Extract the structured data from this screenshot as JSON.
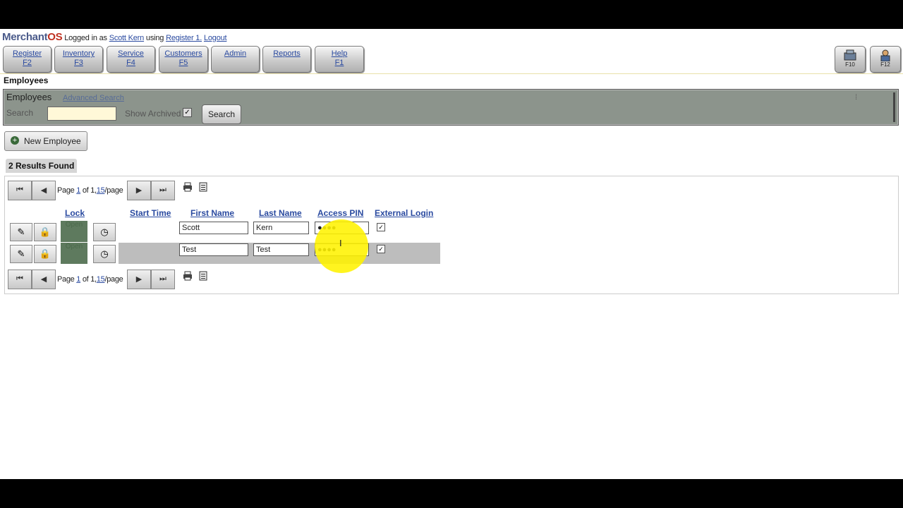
{
  "header": {
    "brand_main": "Merchant",
    "brand_os": "OS",
    "logged_in_as": "Logged in as",
    "user": "Scott Kern",
    "using": "using",
    "register": "Register 1.",
    "logout": "Logout"
  },
  "nav": [
    {
      "label": "Register",
      "key": "F2"
    },
    {
      "label": "Inventory",
      "key": "F3"
    },
    {
      "label": "Service",
      "key": "F4"
    },
    {
      "label": "Customers",
      "key": "F5"
    },
    {
      "label": "Admin",
      "key": ""
    },
    {
      "label": "Reports",
      "key": ""
    },
    {
      "label": "Help",
      "key": "F1"
    }
  ],
  "right_buttons": [
    {
      "label": "F10",
      "icon": "register-icon"
    },
    {
      "label": "F12",
      "icon": "user-icon"
    }
  ],
  "page_title": "Employees",
  "filter_panel": {
    "title": "Employees",
    "link": "Advanced Search",
    "search_label": "Search",
    "search_value": "",
    "archived_label": "Show Archived",
    "search_button": "Search"
  },
  "new_employee_button": "New Employee",
  "results_label": "2 Results Found",
  "pager": {
    "page_word": "Page",
    "page": "1",
    "of": "of",
    "total": "1",
    "per_page": "15",
    "per_page_suffix": "/page"
  },
  "columns": [
    "Lock",
    "Start Time",
    "First Name",
    "Last Name",
    "Access PIN",
    "External Login"
  ],
  "rows": [
    {
      "lock": "Open",
      "start_time": "",
      "first_name": "Scott",
      "last_name": "Kern",
      "pin": "●●●●",
      "external_login": true
    },
    {
      "lock": "Open",
      "start_time": "",
      "first_name": "Test",
      "last_name": "Test",
      "pin": "●●●●",
      "external_login": true
    }
  ],
  "colors": {
    "accent_link": "#2a4aa0",
    "panel": "#8c948c",
    "lock_cell": "#5e7a5e",
    "highlight": "#fff200"
  },
  "cursor": "I"
}
